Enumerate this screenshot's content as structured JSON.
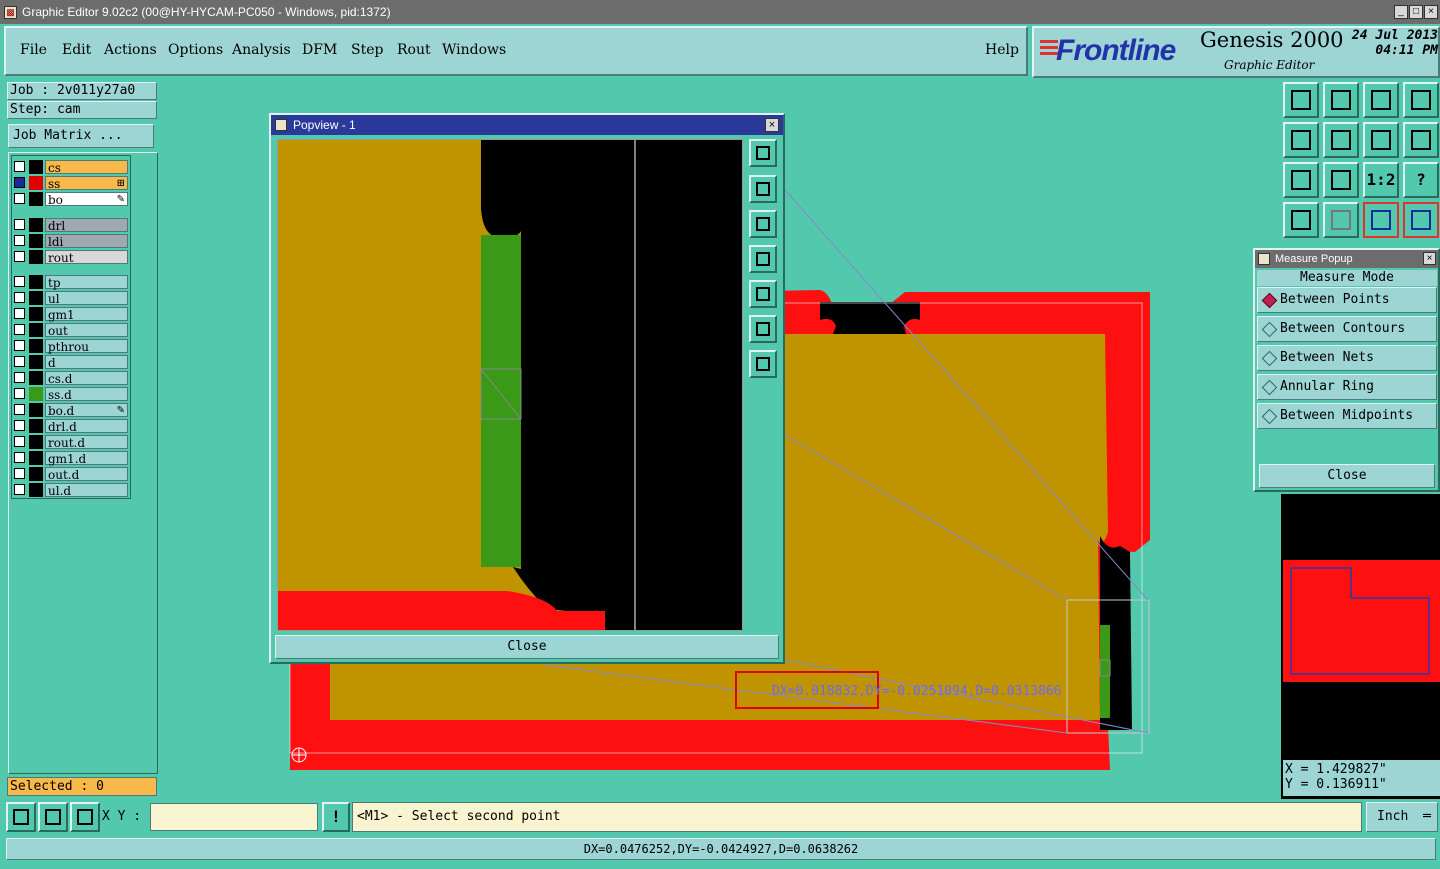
{
  "window": {
    "title": "Graphic Editor 9.02c2 (00@HY-HYCAM-PC050 - Windows, pid:1372)",
    "min": "_",
    "max": "□",
    "close": "×"
  },
  "menu": {
    "items": [
      "File",
      "Edit",
      "Actions",
      "Options",
      "Analysis",
      "DFM",
      "Step",
      "Rout",
      "Windows"
    ],
    "help": "Help"
  },
  "brand": {
    "logo": "Frontline",
    "product": "Genesis 2000",
    "subtitle": "Graphic Editor",
    "date": "24 Jul 2013",
    "time": "04:11 PM"
  },
  "job": {
    "job_label": "Job  : 2v011y27a0",
    "step_label": "Step: cam",
    "matrix_button": "Job Matrix ..."
  },
  "layers": [
    {
      "name": "cs",
      "bg": "#f8b84a",
      "swatch": "#000"
    },
    {
      "name": "ss",
      "bg": "#f8b84a",
      "swatch": "#e00000",
      "mark": "⊞"
    },
    {
      "name": "bo",
      "bg": "#ffffff",
      "swatch": "#000",
      "mark": "✎"
    },
    {
      "name": "drl",
      "bg": "#a0a8b0",
      "swatch": "#000"
    },
    {
      "name": "ldi",
      "bg": "#a0a8b0",
      "swatch": "#000"
    },
    {
      "name": "rout",
      "bg": "#d8d8d8",
      "swatch": "#000"
    },
    {
      "name": "tp",
      "bg": "#9dd4d4",
      "swatch": "#000"
    },
    {
      "name": "ul",
      "bg": "#9dd4d4",
      "swatch": "#000"
    },
    {
      "name": "gm1",
      "bg": "#9dd4d4",
      "swatch": "#000"
    },
    {
      "name": "out",
      "bg": "#9dd4d4",
      "swatch": "#000"
    },
    {
      "name": "pthrou",
      "bg": "#9dd4d4",
      "swatch": "#000"
    },
    {
      "name": "d",
      "bg": "#9dd4d4",
      "swatch": "#000"
    },
    {
      "name": "cs.d",
      "bg": "#9dd4d4",
      "swatch": "#000"
    },
    {
      "name": "ss.d",
      "bg": "#9dd4d4",
      "swatch": "#3a9a18"
    },
    {
      "name": "bo.d",
      "bg": "#9dd4d4",
      "swatch": "#000",
      "mark": "✎"
    },
    {
      "name": "drl.d",
      "bg": "#9dd4d4",
      "swatch": "#000"
    },
    {
      "name": "rout.d",
      "bg": "#9dd4d4",
      "swatch": "#000"
    },
    {
      "name": "gm1.d",
      "bg": "#9dd4d4",
      "swatch": "#000"
    },
    {
      "name": "out.d",
      "bg": "#9dd4d4",
      "swatch": "#000"
    },
    {
      "name": "ul.d",
      "bg": "#9dd4d4",
      "swatch": "#000"
    }
  ],
  "selected": "Selected : 0",
  "popview": {
    "title": "Popview - 1",
    "close": "Close"
  },
  "measure": {
    "title": "Measure Popup",
    "mode_label": "Measure Mode",
    "modes": [
      "Between Points",
      "Between Contours",
      "Between Nets",
      "Annular Ring",
      "Between Midpoints"
    ],
    "close": "Close"
  },
  "coords": {
    "x": "X  =  1.429827\"",
    "y": "Y  =  0.136911\""
  },
  "measure_readout": "DX=0.018832,DY=-0.0251094,D=0.0313866",
  "bottom": {
    "xy_label": "X Y :",
    "input_value": "",
    "prompt": "<M1> - Select second point",
    "units": "Inch"
  },
  "status": "DX=0.0476252,DY=-0.0424927,D=0.0638262",
  "colors": {
    "teal": "#52c8ac",
    "light_teal": "#9dd4d4",
    "copper": "#bf9400",
    "red": "#ff1010",
    "green": "#3a9a18"
  }
}
